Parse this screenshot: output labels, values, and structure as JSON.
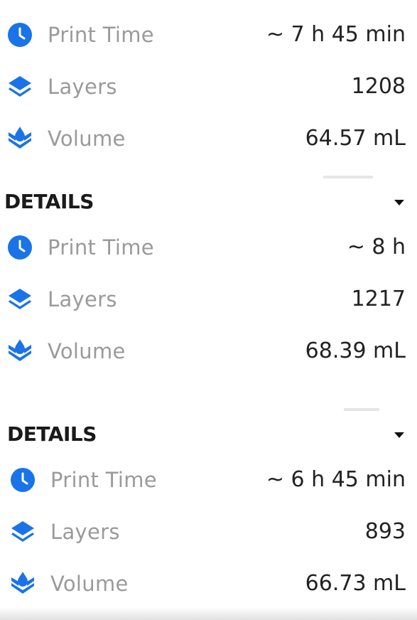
{
  "colors": {
    "accent": "#1a73e8",
    "label": "#9a9a9a",
    "value": "#222222",
    "heading": "#1a1a1a"
  },
  "panels": [
    {
      "show_header": false,
      "header": "",
      "rows": [
        {
          "icon": "clock-icon",
          "label": "Print Time",
          "value": "~ 7 h 45 min"
        },
        {
          "icon": "layers-icon",
          "label": "Layers",
          "value": "1208"
        },
        {
          "icon": "resin-volume-icon",
          "label": "Volume",
          "value": "64.57 mL"
        }
      ]
    },
    {
      "show_header": true,
      "header": "DETAILS",
      "rows": [
        {
          "icon": "clock-icon",
          "label": "Print Time",
          "value": "~ 8 h"
        },
        {
          "icon": "layers-icon",
          "label": "Layers",
          "value": "1217"
        },
        {
          "icon": "resin-volume-icon",
          "label": "Volume",
          "value": "68.39 mL"
        }
      ]
    },
    {
      "show_header": true,
      "header": "DETAILS",
      "rows": [
        {
          "icon": "clock-icon",
          "label": "Print Time",
          "value": "~ 6 h 45 min"
        },
        {
          "icon": "layers-icon",
          "label": "Layers",
          "value": "893"
        },
        {
          "icon": "resin-volume-icon",
          "label": "Volume",
          "value": "66.73 mL"
        }
      ]
    }
  ]
}
